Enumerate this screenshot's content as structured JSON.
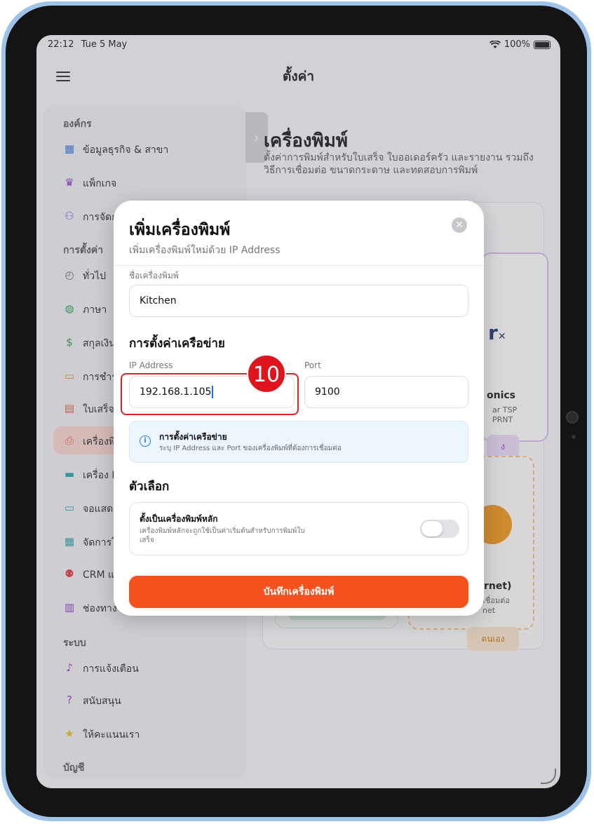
{
  "status_bar": {
    "time": "22:12",
    "date": "Tue 5 May",
    "battery": "100%"
  },
  "nav": {
    "title": "ตั้งค่า"
  },
  "sidebar": {
    "section_org": "องค์กร",
    "section_settings": "การตั้งค่า",
    "section_system": "ระบบ",
    "section_account": "บัญชี",
    "items": [
      {
        "label": "ข้อมูลธุรกิจ & สาขา",
        "icon": "store-icon",
        "color": "#2f6fd6"
      },
      {
        "label": "แพ็กเกจ",
        "icon": "crown-icon",
        "color": "#8a2fc9"
      },
      {
        "label": "การจัดก",
        "icon": "users-icon",
        "color": "#5560d9"
      },
      {
        "label": "ทั่วไป",
        "icon": "clock-icon",
        "color": "#666666"
      },
      {
        "label": "ภาษา",
        "icon": "globe-icon",
        "color": "#1f9a4a"
      },
      {
        "label": "สกุลเงิน",
        "icon": "dollar-icon",
        "color": "#1f9a4a"
      },
      {
        "label": "การชำร",
        "icon": "card-icon",
        "color": "#e58a1c"
      },
      {
        "label": "ใบเสร็จ",
        "icon": "document-icon",
        "color": "#e0563b"
      },
      {
        "label": "เครื่องพิ",
        "icon": "printer-icon",
        "color": "#e0563b"
      },
      {
        "label": "เครื่อง P",
        "icon": "monitor-icon",
        "color": "#1ea0a8"
      },
      {
        "label": "จอแสด",
        "icon": "display-icon",
        "color": "#1ea0a8"
      },
      {
        "label": "จัดการโ",
        "icon": "table-icon",
        "color": "#1ea0a8"
      },
      {
        "label": "CRM แ",
        "icon": "crm-icon",
        "color": "#e0353b"
      },
      {
        "label": "ช่องทาง",
        "icon": "building-icon",
        "color": "#8a2fc9"
      },
      {
        "label": "การแจ้งเตือน",
        "icon": "bell-icon",
        "color": "#8a2fc9"
      },
      {
        "label": "สนับสนุน",
        "icon": "help-icon",
        "color": "#8a2fc9"
      },
      {
        "label": "ให้คะแนนเรา",
        "icon": "star-icon",
        "color": "#e8b90f"
      }
    ]
  },
  "content": {
    "title": "เครื่องพิมพ์",
    "subtitle": "ตั้งค่าการพิมพ์สำหรับใบเสร็จ ใบออเดอร์ครัว และรายงาน รวมถึง วิธีการเชื่อมต่อ ขนาดกระดาษ และทดสอบการพิมพ์",
    "card1_text": "onics",
    "card1_small1": "ar TSP",
    "card1_small2": "PRNT",
    "card1_btn": "ง",
    "card2_text": "rnet)",
    "card2_small1": "เชื่อมต่อ",
    "card2_small2": "net",
    "card2_btn": "ตนเอง"
  },
  "modal": {
    "title": "เพิ่มเครื่องพิมพ์",
    "subtitle": "เพิ่มเครื่องพิมพ์ใหม่ด้วย IP Address",
    "printer_name_label": "ชื่อเครื่องพิมพ์",
    "printer_name_value": "Kitchen",
    "network_section": "การตั้งค่าเครือข่าย",
    "ip_label": "IP Address",
    "ip_value": "192.168.1.105",
    "port_label": "Port",
    "port_value": "9100",
    "info_title": "การตั้งค่าเครือข่าย",
    "info_text": "ระบุ IP Address และ Port ของเครื่องพิมพ์ที่ต้องการเชื่อมต่อ",
    "options_section": "ตัวเลือก",
    "default_title": "ตั้งเป็นเครื่องพิมพ์หลัก",
    "default_desc": "เครื่องพิมพ์หลักจะถูกใช้เป็นค่าเริ่มต้นสำหรับการพิมพ์ใบเสร็จ",
    "default_enabled": false,
    "save_label": "บันทึกเครื่องพิมพ์"
  },
  "annotation": {
    "step_number": "10",
    "highlight_color": "#e01e25"
  },
  "colors": {
    "accent": "#f4511e",
    "active_sidebar": "#fbd5cd"
  }
}
